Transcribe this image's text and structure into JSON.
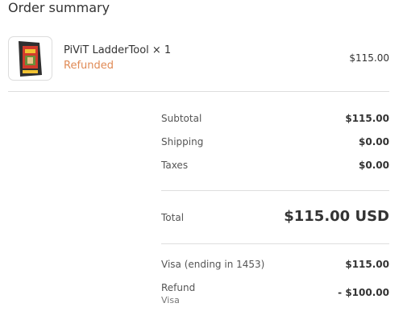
{
  "heading": "Order summary",
  "product": {
    "name": "PiViT LadderTool",
    "quantity": "× 1",
    "status": "Refunded",
    "price": "$115.00",
    "image_icon": "product-package-image"
  },
  "totals": {
    "subtotal_label": "Subtotal",
    "subtotal_value": "$115.00",
    "shipping_label": "Shipping",
    "shipping_value": "$0.00",
    "taxes_label": "Taxes",
    "taxes_value": "$0.00",
    "total_label": "Total",
    "total_value": "$115.00 USD"
  },
  "payments": {
    "card_label": "Visa (ending in 1453)",
    "card_value": "$115.00",
    "refund_label": "Refund",
    "refund_method": "Visa",
    "refund_value": "- $100.00"
  },
  "colors": {
    "refunded": "#e08a55"
  }
}
